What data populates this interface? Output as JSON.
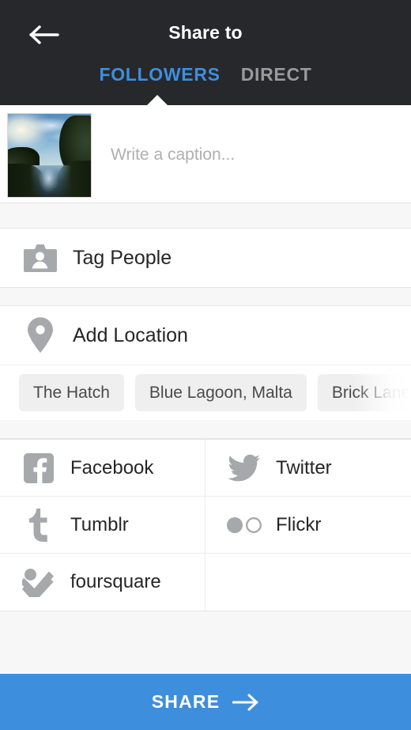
{
  "header": {
    "title": "Share to",
    "back_icon": "arrow-left-icon",
    "tabs": [
      {
        "label": "FOLLOWERS",
        "active": true
      },
      {
        "label": "DIRECT",
        "active": false
      }
    ]
  },
  "caption": {
    "placeholder": "Write a caption...",
    "value": "",
    "thumbnail_alt": "canal-sunset-photo"
  },
  "actions": [
    {
      "label": "Tag People",
      "icon": "tag-people-icon"
    },
    {
      "label": "Add Location",
      "icon": "location-pin-icon"
    }
  ],
  "location_suggestions": [
    {
      "label": "The Hatch"
    },
    {
      "label": "Blue Lagoon, Malta"
    },
    {
      "label": "Brick Lane"
    }
  ],
  "social": [
    [
      {
        "label": "Facebook",
        "icon": "facebook-icon"
      },
      {
        "label": "Twitter",
        "icon": "twitter-icon"
      }
    ],
    [
      {
        "label": "Tumblr",
        "icon": "tumblr-icon"
      },
      {
        "label": "Flickr",
        "icon": "flickr-icon"
      }
    ],
    [
      {
        "label": "foursquare",
        "icon": "foursquare-icon"
      },
      {
        "label": "",
        "icon": ""
      }
    ]
  ],
  "share": {
    "label": "SHARE",
    "arrow_icon": "arrow-right-icon"
  },
  "colors": {
    "header_bg": "#26282b",
    "accent_blue": "#3e8ede",
    "inactive_tab": "#9a9a9a",
    "icon_gray": "#a6a8ac",
    "page_bg": "#f7f7f7",
    "card_bg": "#ffffff",
    "chip_bg": "#efefef"
  }
}
